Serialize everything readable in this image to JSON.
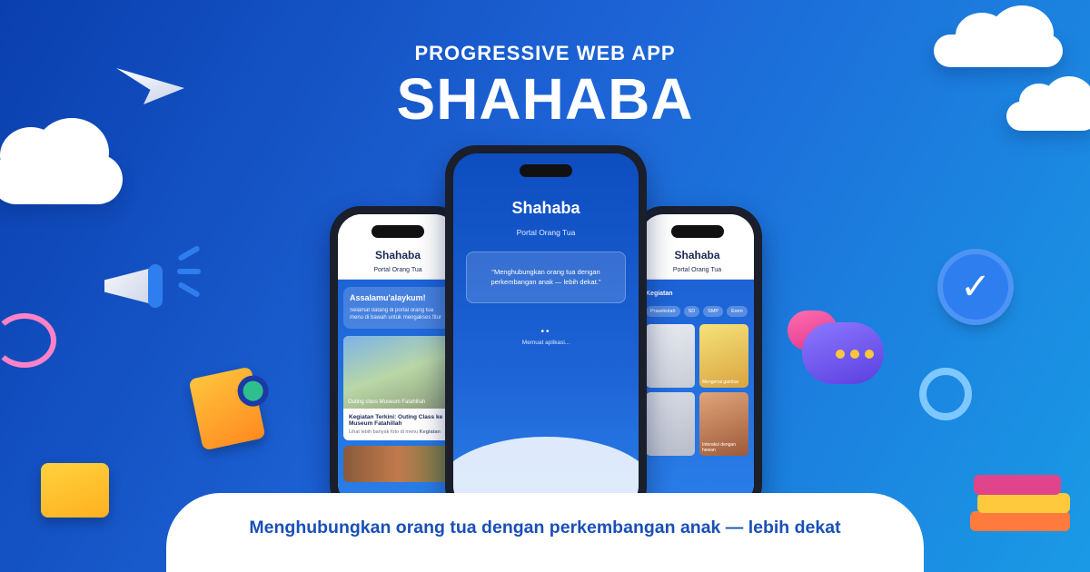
{
  "header": {
    "kicker": "PROGRESSIVE WEB APP",
    "title": "SHAHABA"
  },
  "phone_left": {
    "title": "Shahaba",
    "subtitle": "Portal Orang Tua",
    "welcome_title": "Assalamu'alaykum!",
    "welcome_text": "Selamat datang di portal orang tua menu di bawah untuk mengakses fitur",
    "photo_caption": "Outing class Museum Fatahillah",
    "news_title": "Kegiatan Terkini: Outing Class ke Museum Fatahillah",
    "news_text": "Lihat lebih banyak foto di menu",
    "news_link": "Kegiatan"
  },
  "phone_center": {
    "title": "Shahaba",
    "subtitle": "Portal Orang Tua",
    "quote": "\"Menghubungkan orang tua dengan perkembangan anak — lebih dekat.\"",
    "loading_dots": "••",
    "loading_text": "Memuat aplikasi..."
  },
  "phone_right": {
    "title": "Shahaba",
    "subtitle": "Portal Orang Tua",
    "section_label": "Kegiatan",
    "chips": [
      "Prasekolah",
      "SD",
      "SMP",
      "Even"
    ],
    "tiles": [
      "",
      "Mengenal gambar",
      "",
      "Interaksi dengan hewan"
    ]
  },
  "icons": [
    "paper-plane-icon",
    "megaphone-icon",
    "document-search-icon",
    "folder-icon",
    "verified-badge-icon",
    "chat-bubble-icon",
    "spiral-icon",
    "books-icon"
  ],
  "colors": {
    "background_start": "#0a3fae",
    "background_end": "#1a9ae6",
    "tagline": "#1a4fb8"
  },
  "footer": {
    "tagline": "Menghubungkan orang tua dengan perkembangan anak — lebih dekat"
  }
}
